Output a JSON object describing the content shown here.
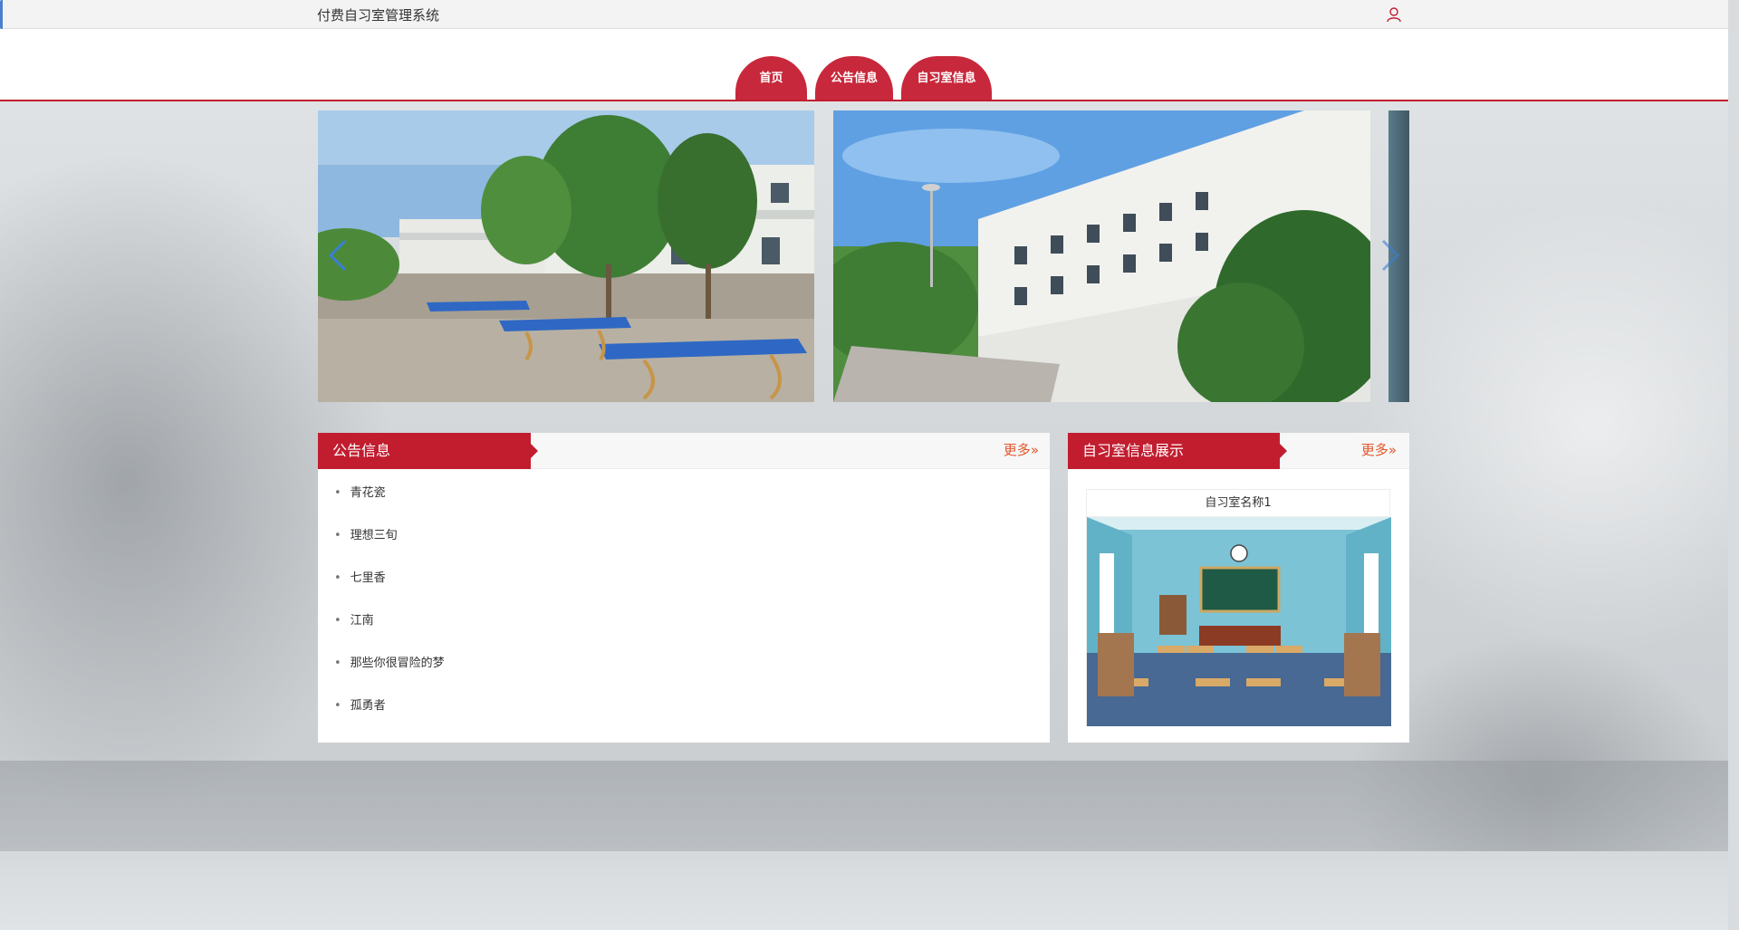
{
  "app": {
    "title": "付费自习室管理系统"
  },
  "nav": {
    "home": "首页",
    "notice": "公告信息",
    "room": "自习室信息"
  },
  "notice_panel": {
    "title": "公告信息",
    "more": "更多",
    "items": [
      "青花瓷",
      "理想三旬",
      "七里香",
      "江南",
      "那些你很冒险的梦",
      "孤勇者"
    ]
  },
  "room_panel": {
    "title": "自习室信息展示",
    "more": "更多",
    "card": {
      "name": "自习室名称1"
    }
  },
  "icons": {
    "user": "user-icon",
    "prev": "chevron-left-icon",
    "next": "chevron-right-icon",
    "more": "double-chevron-right-icon"
  },
  "colors": {
    "accent": "#c21d2f",
    "nav_tab": "#c8283b",
    "more_link": "#e2562a"
  }
}
